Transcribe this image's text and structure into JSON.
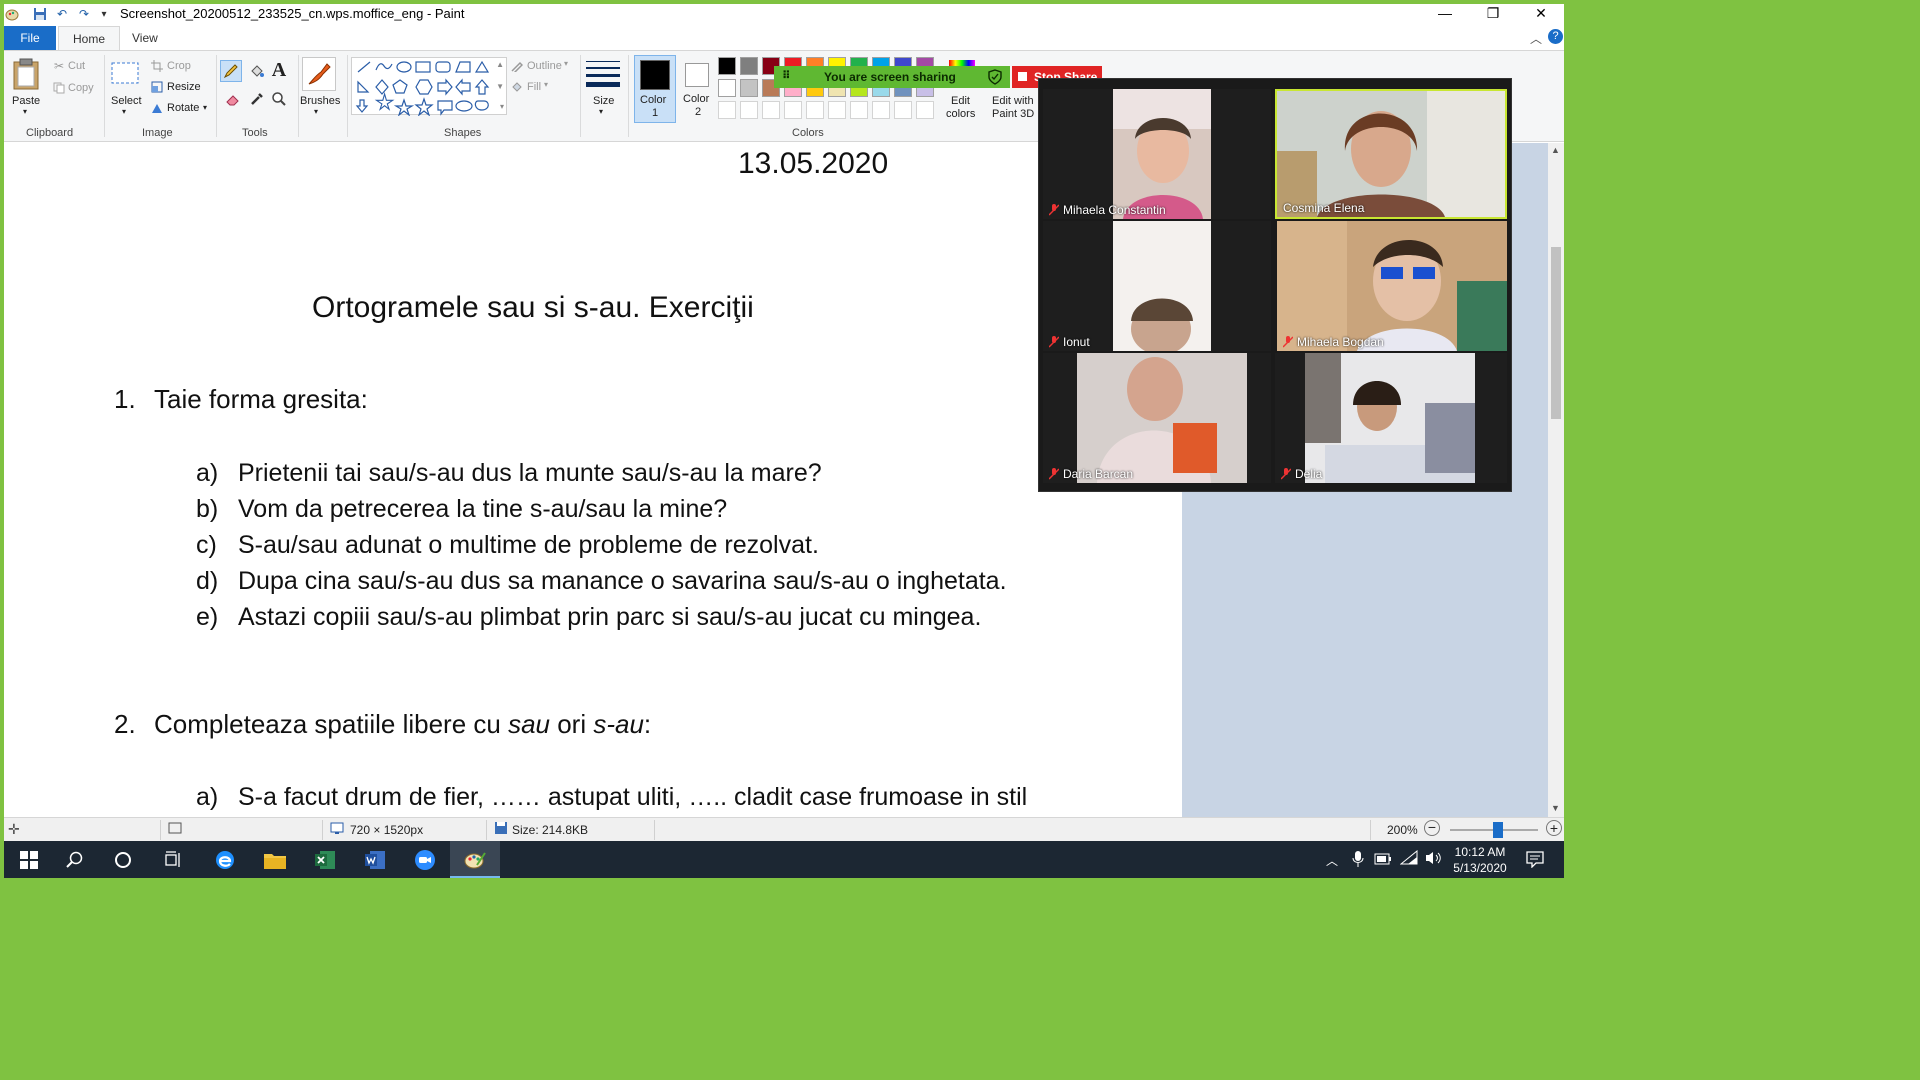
{
  "window": {
    "title": "Screenshot_20200512_233525_cn.wps.moffice_eng - Paint"
  },
  "tabs": [
    {
      "label": "File"
    },
    {
      "label": "Home"
    },
    {
      "label": "View"
    }
  ],
  "ribbon": {
    "clipboard": {
      "paste": "Paste",
      "cut": "Cut",
      "copy": "Copy",
      "group": "Clipboard"
    },
    "image": {
      "select": "Select",
      "crop": "Crop",
      "resize": "Resize",
      "rotate": "Rotate",
      "group": "Image"
    },
    "tools": {
      "group": "Tools"
    },
    "brushes": {
      "label": "Brushes"
    },
    "shapes": {
      "outline": "Outline",
      "fill": "Fill",
      "group": "Shapes"
    },
    "size": {
      "label": "Size"
    },
    "color1": {
      "label": "Color",
      "num": "1"
    },
    "color2": {
      "label": "Color",
      "num": "2"
    },
    "colors": {
      "group": "Colors",
      "edit": "Edit",
      "edit2": "colors",
      "paint3d": "Edit with",
      "paint3d2": "Paint 3D"
    },
    "palette_row1": [
      "#000000",
      "#7f7f7f",
      "#880015",
      "#ed1c24",
      "#ff7f27",
      "#fff200",
      "#22b14c",
      "#00a2e8",
      "#3f48cc",
      "#a349a4"
    ],
    "palette_row2": [
      "#ffffff",
      "#c3c3c3",
      "#b97a57",
      "#ffaec9",
      "#ffc90e",
      "#efe4b0",
      "#b5e61d",
      "#99d9ea",
      "#7092be",
      "#c8bfe7"
    ],
    "active_color1": "#000000",
    "active_color2": "#ffffff"
  },
  "document": {
    "date": "13.05.2020",
    "title": "Ortogramele sau si s-au. Exerciţii",
    "q1": {
      "num": "1.",
      "text": "Taie forma gresita:"
    },
    "q1_items": [
      {
        "letter": "a)",
        "text": "Prietenii tai sau/s-au dus la munte sau/s-au la mare?"
      },
      {
        "letter": "b)",
        "text": "Vom da petrecerea la tine s-au/sau la mine?"
      },
      {
        "letter": "c)",
        "text": "S-au/sau adunat o multime de probleme de rezolvat."
      },
      {
        "letter": "d)",
        "text": "Dupa cina sau/s-au dus sa manance o savarina sau/s-au o inghetata."
      },
      {
        "letter": "e)",
        "text": "Astazi copiii sau/s-au plimbat prin parc si sau/s-au jucat cu mingea."
      }
    ],
    "q2": {
      "num": "2.",
      "text_pre": "Completeaza spatiile libere cu ",
      "em1": "sau",
      "text_mid": " ori ",
      "em2": "s-au",
      "text_post": ":"
    },
    "q2_items": [
      {
        "letter": "a)",
        "text": "S-a facut drum de fier, ……  astupat uliti, …..  cladit case frumoase in stil"
      }
    ]
  },
  "statusbar": {
    "dimensions": "720 × 1520px",
    "size": "Size: 214.8KB",
    "zoom": "200%"
  },
  "taskbar": {
    "time": "10:12 AM",
    "date": "5/13/2020"
  },
  "zoom": {
    "sharing": "You are screen sharing",
    "stop": "Stop Share",
    "participants": [
      {
        "name": "Mihaela Constantin"
      },
      {
        "name": "Cosmina Elena"
      },
      {
        "name": "Ionut"
      },
      {
        "name": "Mihaela Bogdan"
      },
      {
        "name": "Daria Barcan"
      },
      {
        "name": "Delia"
      }
    ]
  }
}
